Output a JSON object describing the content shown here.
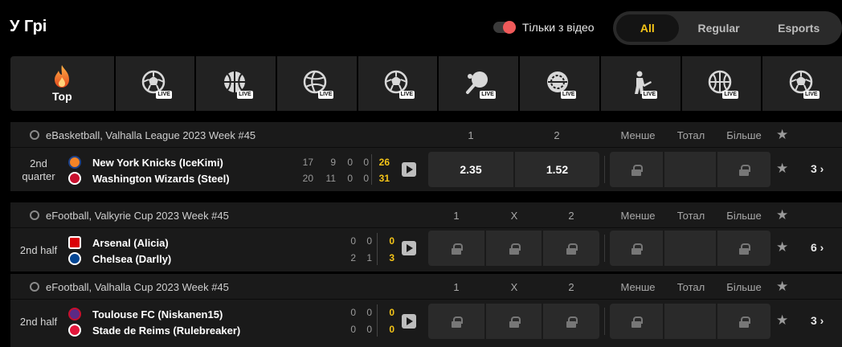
{
  "header": {
    "title": "У Грі",
    "video_label": "Тільки з відео"
  },
  "filter": {
    "all": "All",
    "regular": "Regular",
    "esports": "Esports"
  },
  "sports": [
    {
      "name": "Top",
      "icon": "fire-icon"
    },
    {
      "name": "",
      "icon": "esoccer-live-icon",
      "badge": "LIVE"
    },
    {
      "name": "",
      "icon": "ebasketball-live-icon",
      "badge": "LIVE"
    },
    {
      "name": "",
      "icon": "evolleyball-live-icon",
      "badge": "LIVE"
    },
    {
      "name": "",
      "icon": "esoccer2-live-icon",
      "badge": "LIVE"
    },
    {
      "name": "",
      "icon": "table-tennis-live-icon",
      "badge": "LIVE"
    },
    {
      "name": "",
      "icon": "ehockey-live-icon",
      "badge": "LIVE"
    },
    {
      "name": "",
      "icon": "cs-live-icon",
      "badge": "LIVE"
    },
    {
      "name": "",
      "icon": "ebasketball2-live-icon",
      "badge": "LIVE"
    },
    {
      "name": "",
      "icon": "esoccer3-live-icon",
      "badge": "LIVE"
    }
  ],
  "matches": [
    {
      "league": "eBasketball, Valhalla League 2023 Week #45",
      "cols": [
        "1",
        "2"
      ],
      "total_cols": [
        "Менше",
        "Тотал",
        "Більше"
      ],
      "period_line1": "2nd",
      "period_line2": "quarter",
      "team1": "New York Knicks (IceKimi)",
      "team2": "Washington Wizards (Steel)",
      "scores1": [
        "17",
        "9",
        "0",
        "0"
      ],
      "total1": "26",
      "scores2": [
        "20",
        "11",
        "0",
        "0"
      ],
      "total2": "31",
      "odds": [
        "2.35",
        "1.52"
      ],
      "more": "3 ›"
    },
    {
      "league": "eFootball, Valkyrie Cup 2023 Week #45",
      "cols": [
        "1",
        "X",
        "2"
      ],
      "total_cols": [
        "Менше",
        "Тотал",
        "Більше"
      ],
      "period": "2nd half",
      "team1": "Arsenal (Alicia)",
      "team2": "Chelsea (Darlly)",
      "scores1": [
        "0",
        "0"
      ],
      "total1": "0",
      "scores2": [
        "2",
        "1"
      ],
      "total2": "3",
      "more": "6 ›"
    },
    {
      "league": "eFootball, Valhalla Cup 2023 Week #45",
      "cols": [
        "1",
        "X",
        "2"
      ],
      "total_cols": [
        "Менше",
        "Тотал",
        "Більше"
      ],
      "period": "2nd half",
      "team1": "Toulouse FC (Niskanen15)",
      "team2": "Stade de Reims (Rulebreaker)",
      "scores1": [
        "0",
        "0"
      ],
      "total1": "0",
      "scores2": [
        "0",
        "0"
      ],
      "total2": "0",
      "more": "3 ›"
    }
  ],
  "colors": {
    "accent": "#f5c518",
    "toggle": "#f05a5a",
    "panel": "#1a1a1a",
    "tile": "#222222"
  }
}
